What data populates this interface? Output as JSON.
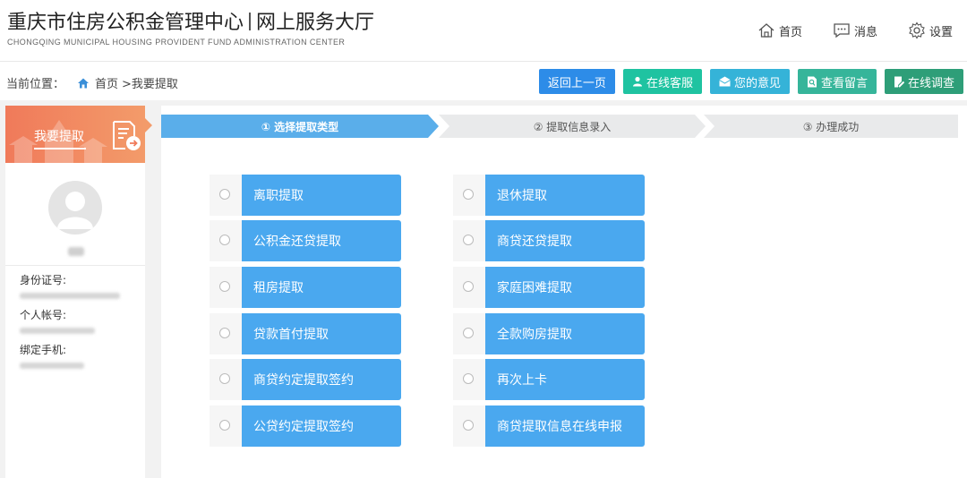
{
  "header": {
    "title_left": "重庆市住房公积金管理中心",
    "title_right": "网上服务大厅",
    "subtitle": "CHONGQING MUNICIPAL HOUSING PROVIDENT FUND ADMINISTRATION CENTER",
    "nav": [
      {
        "label": "首页",
        "icon": "home-icon"
      },
      {
        "label": "消息",
        "icon": "message-icon"
      },
      {
        "label": "设置",
        "icon": "gear-icon"
      }
    ]
  },
  "breadcrumb": {
    "prefix": "当前位置：",
    "home": "首页",
    "current": ">我要提取"
  },
  "actions": [
    {
      "label": "返回上一页",
      "color": "#2d8ce8",
      "icon": ""
    },
    {
      "label": "在线客服",
      "color": "#1fc3a1",
      "icon": "person-icon"
    },
    {
      "label": "您的意见",
      "color": "#35b3d8",
      "icon": "mail-icon"
    },
    {
      "label": "查看留言",
      "color": "#36b59a",
      "icon": "search-doc-icon"
    },
    {
      "label": "在线调查",
      "color": "#2e9e78",
      "icon": "edit-icon"
    }
  ],
  "sidebar": {
    "title": "我要提取",
    "id_label": "身份证号:",
    "account_label": "个人帐号:",
    "phone_label": "绑定手机:"
  },
  "steps": [
    {
      "label": "① 选择提取类型",
      "active": true
    },
    {
      "label": "② 提取信息录入",
      "active": false
    },
    {
      "label": "③ 办理成功",
      "active": false
    }
  ],
  "options_left": [
    "离职提取",
    "公积金还贷提取",
    "租房提取",
    "贷款首付提取",
    "商贷约定提取签约",
    "公贷约定提取签约"
  ],
  "options_right": [
    "退休提取",
    "商贷还贷提取",
    "家庭困难提取",
    "全款购房提取",
    "再次上卡",
    "商贷提取信息在线申报"
  ],
  "colors": {
    "accent": "#4aa8ef",
    "step_active": "#5aaeea",
    "step_inactive": "#e9eaeb",
    "sidebar_header": "#f07a5a"
  }
}
